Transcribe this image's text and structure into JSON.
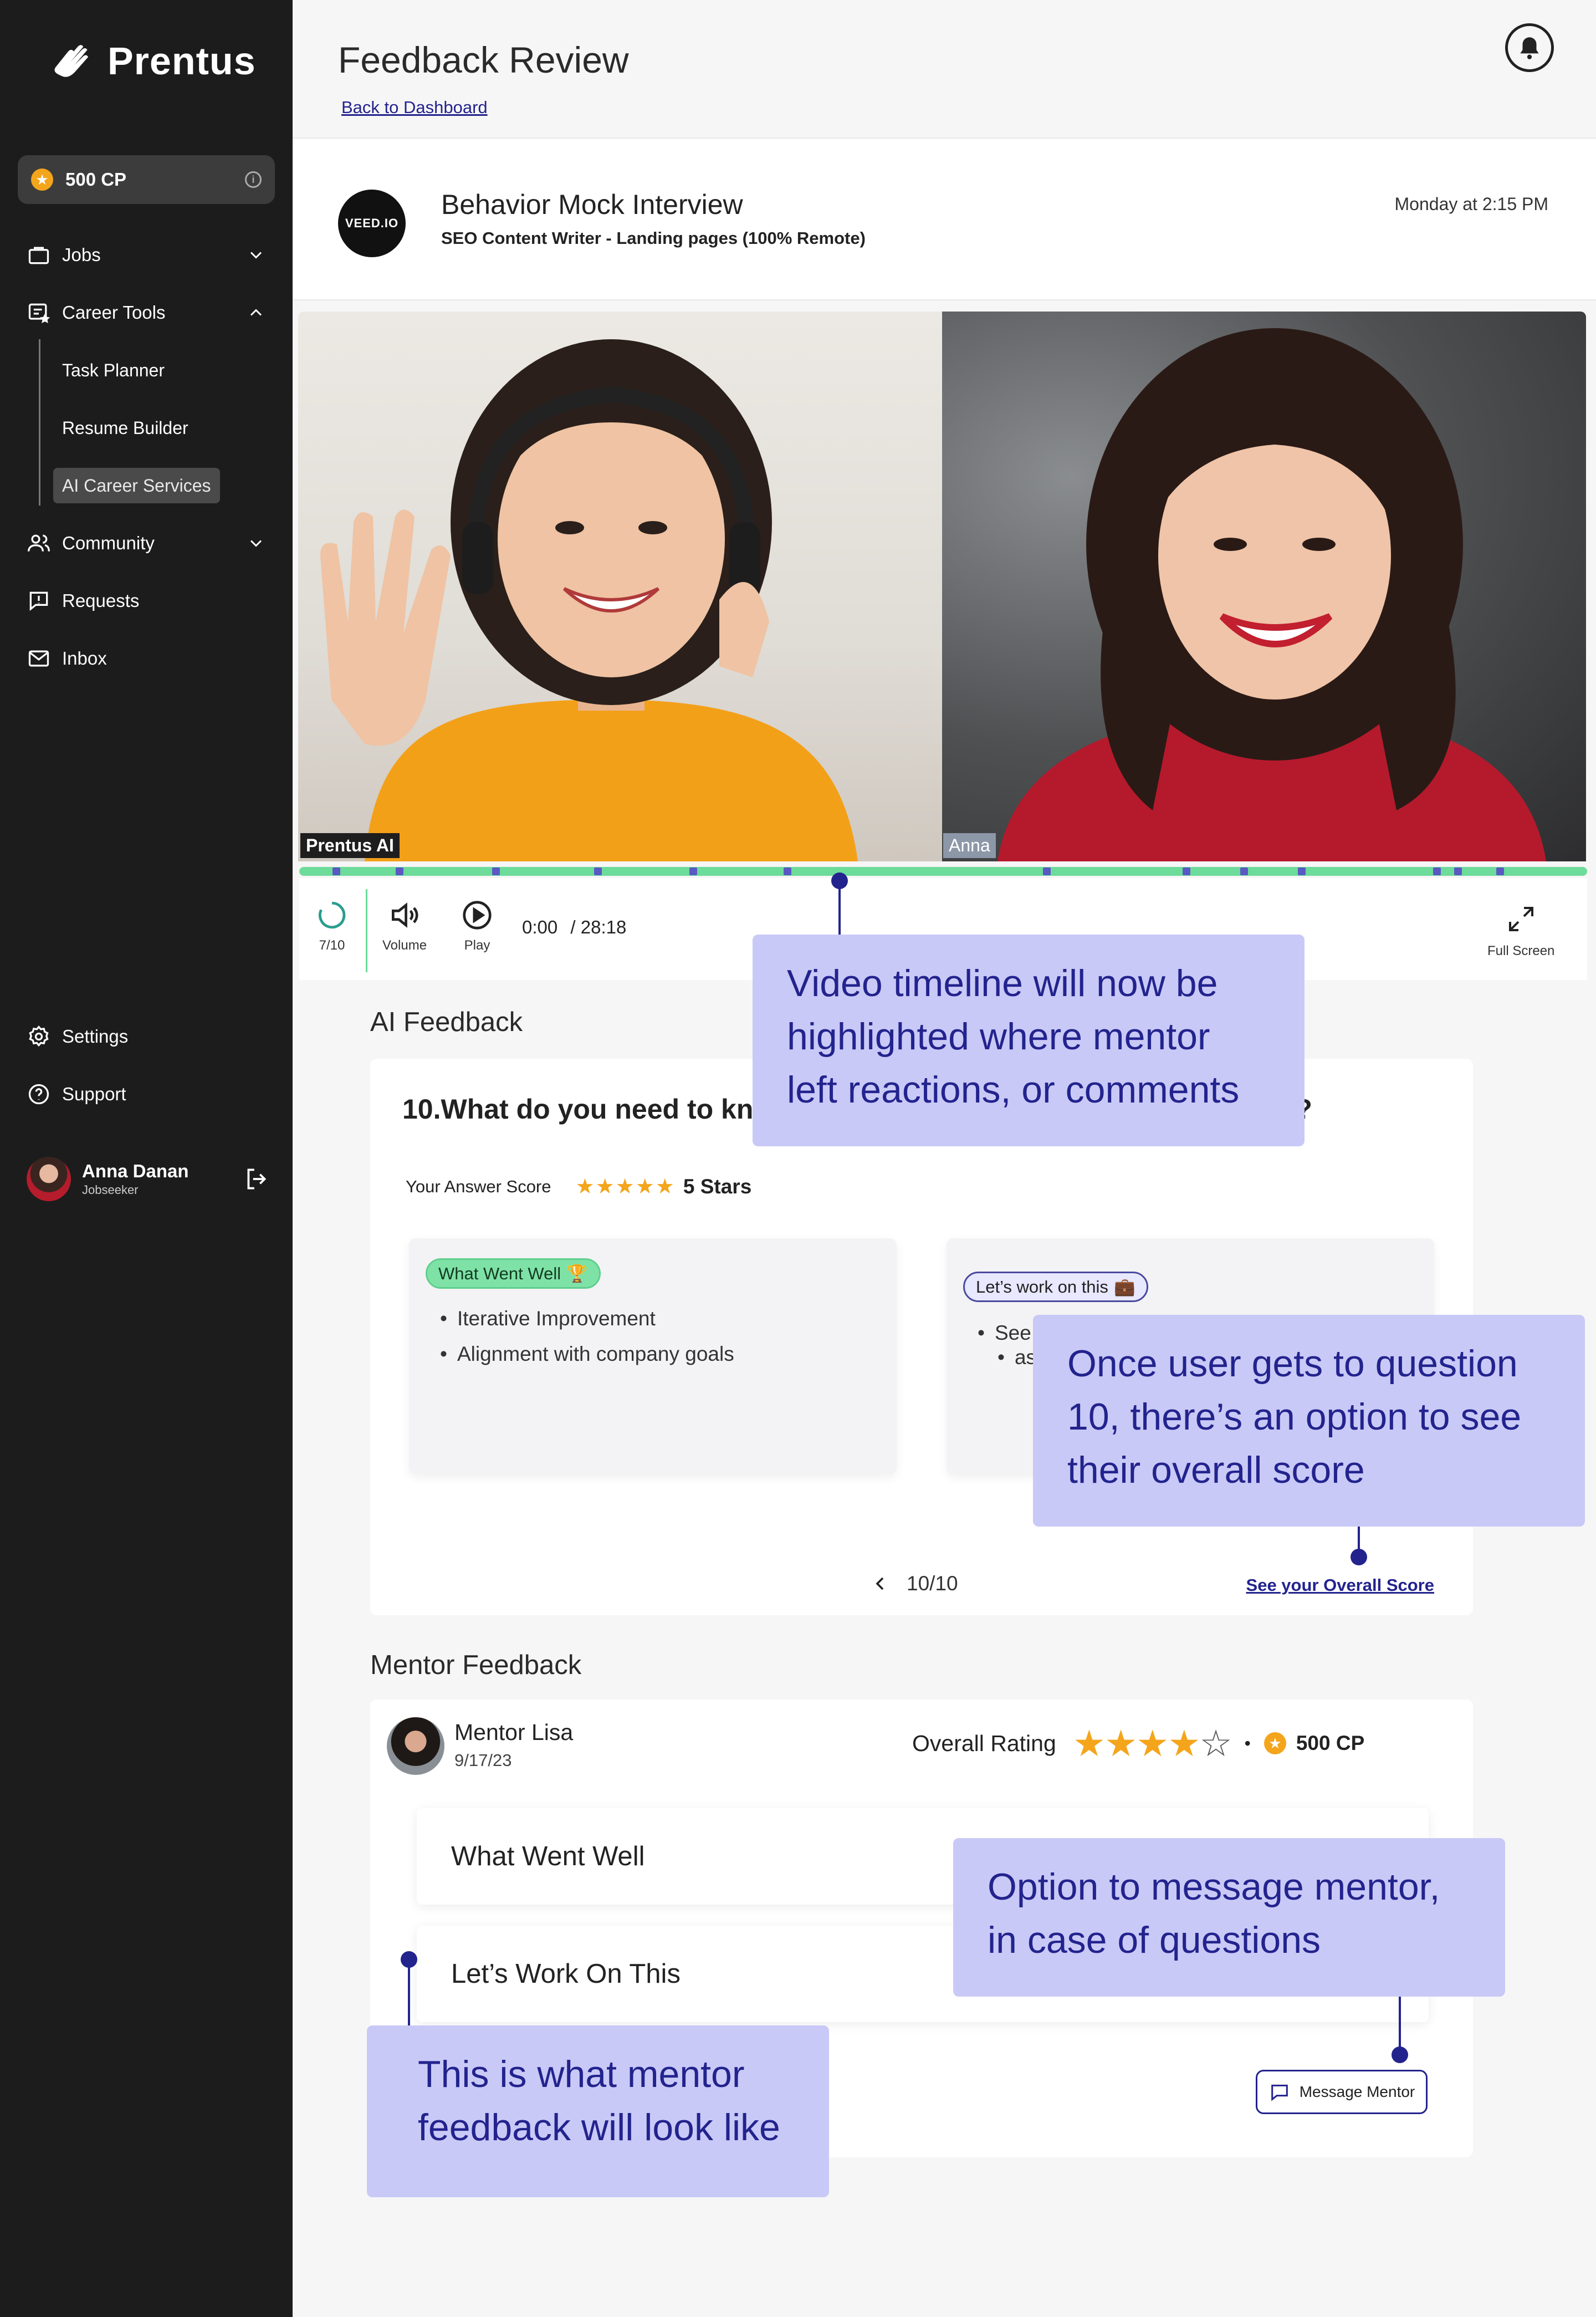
{
  "brand": {
    "name": "Prentus",
    "logo_icon": "hand-wave-icon"
  },
  "sidebar": {
    "cp": "500 CP",
    "items": [
      {
        "label": "Jobs",
        "icon": "briefcase-icon"
      },
      {
        "label": "Career Tools",
        "icon": "career-tools-icon"
      },
      {
        "label": "Community",
        "icon": "people-icon"
      },
      {
        "label": "Requests",
        "icon": "request-icon"
      },
      {
        "label": "Inbox",
        "icon": "mail-icon"
      }
    ],
    "career_tools_sub": [
      "Task Planner",
      "Resume Builder",
      "AI Career Services"
    ],
    "bottom": [
      {
        "label": "Settings",
        "icon": "gear-icon"
      },
      {
        "label": "Support",
        "icon": "help-icon"
      }
    ],
    "user": {
      "name": "Anna Danan",
      "role": "Jobseeker"
    }
  },
  "header": {
    "title": "Feedback Review",
    "back_link": "Back to Dashboard"
  },
  "interview": {
    "logo_text": "VEED.IO",
    "title": "Behavior Mock Interview",
    "subtitle": "SEO Content Writer - Landing pages (100% Remote)",
    "datetime": "Monday at 2:15 PM"
  },
  "video": {
    "left_name": "Prentus AI",
    "right_name": "Anna",
    "progress_label": "7/10",
    "volume_label": "Volume",
    "play_label": "Play",
    "current_time": "0:00",
    "total_time": "/ 28:18",
    "fullscreen_label": "Full Screen"
  },
  "ai_feedback": {
    "section_title": "AI Feedback",
    "question": "10.What do you need to kn",
    "question_end": "?",
    "score_label": "Your Answer Score",
    "score_stars": "5 Stars",
    "stars_value": 5,
    "went_well_badge": "What Went Well",
    "went_well_items": [
      "Iterative Improvement",
      "Alignment with company goals"
    ],
    "work_on_badge": "Let’s work on this",
    "work_on_items": [
      "See",
      "aspe"
    ],
    "pager": "10/10",
    "overall_link": "See your Overall Score"
  },
  "mentor_feedback": {
    "section_title": "Mentor Feedback",
    "mentor_name": "Mentor Lisa",
    "date": "9/17/23",
    "overall_label": "Overall Rating",
    "rating": 4,
    "rating_max": 5,
    "cp": "500 CP",
    "went_well": "What Went Well",
    "work_on": "Let’s Work On This",
    "message_button": "Message Mentor"
  },
  "annotations": {
    "timeline_note": "Video timeline will now be highlighted where mentor left reactions, or comments",
    "score_note": "Once user gets to question 10, there’s an option to see their overall score",
    "message_note": "Option to message mentor, in case of questions",
    "mentor_note": "This is what mentor feedback will look like"
  },
  "colors": {
    "sidebar_bg": "#1c1c1c",
    "accent_navy": "#23238e",
    "timeline_green": "#6ddb9a",
    "timeline_marker": "#5a59c4",
    "annotation_bg": "#c9c9f7",
    "star": "#f4a51c"
  }
}
